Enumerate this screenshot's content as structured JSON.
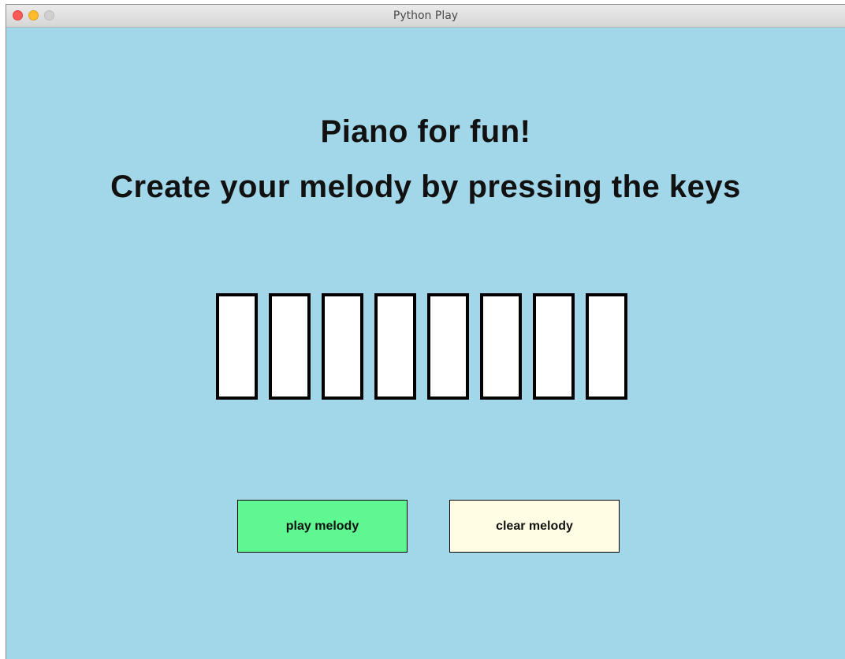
{
  "window": {
    "title": "Python Play"
  },
  "colors": {
    "background": "#a1d7e8",
    "key_fill": "#ffffff",
    "key_border": "#000000",
    "play_button": "#5ef791",
    "clear_button": "#fffde4"
  },
  "content": {
    "heading": "Piano for fun!",
    "subheading": "Create your melody by pressing the keys"
  },
  "piano": {
    "key_count": 8,
    "keys": [
      "key-1",
      "key-2",
      "key-3",
      "key-4",
      "key-5",
      "key-6",
      "key-7",
      "key-8"
    ]
  },
  "buttons": {
    "play_label": "play melody",
    "clear_label": "clear melody"
  }
}
